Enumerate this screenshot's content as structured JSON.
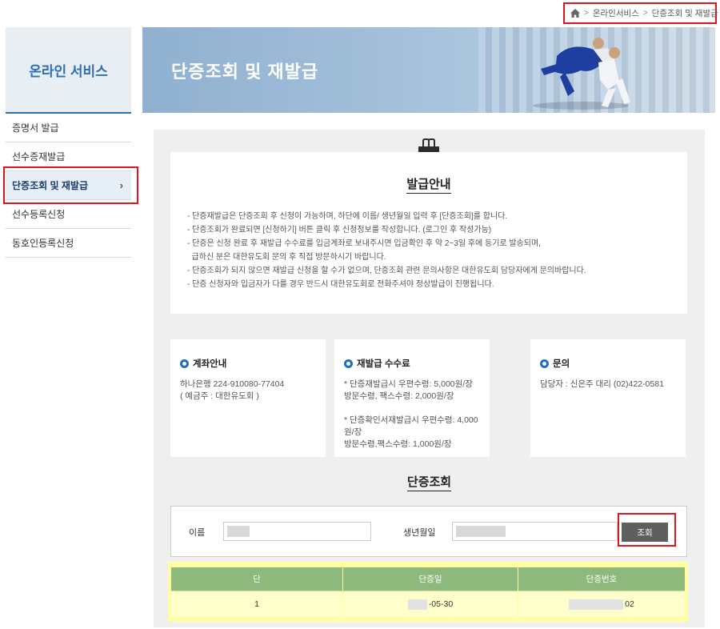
{
  "breadcrumb": {
    "home_icon": "home-icon",
    "items": [
      "온라인서비스",
      "단증조회 및 재발급"
    ],
    "separator": ">"
  },
  "sidebar": {
    "title": "온라인 서비스",
    "items": [
      {
        "label": "증명서 발급"
      },
      {
        "label": "선수증재발급"
      },
      {
        "label": "단증조회 및 재발급",
        "active": true,
        "chevron": "chevron-right-icon"
      },
      {
        "label": "선수등록신청"
      },
      {
        "label": "동호인등록신청"
      }
    ]
  },
  "banner": {
    "title": "단증조회 및 재발급"
  },
  "notice": {
    "icon": "clipboard-icon",
    "title": "발급안내",
    "lines": [
      "- 단증재발급은 단증조회 후 신청이 가능하며, 하단에 이름/ 생년월일 입력 후 [단증조회]를 합니다.",
      "- 단증조회가 완료되면 [신청하기] 버튼 클릭 후 신청정보를 작성합니다. (로그인 후 작성가능)",
      "- 단증은 신청 완료 후 재발급 수수료를 입금계좌로 보내주시면 입금확인 후 약 2~3일 후에 등기로 발송되며,",
      "  급하신 분은 대한유도회 문의 후 직접 방문하시기 바랍니다.",
      "- 단증조회가 되지 않으면 재발급 신청을 할 수가 없으며, 단증조회 관련 문의사항은 대한유도회 담당자에게 문의바랍니다.",
      "- 단증 신청자와 입금자가 다를 경우 반드시 대한유도회로 전화주셔야 정상발급이 진행됩니다."
    ]
  },
  "cards": {
    "account": {
      "title": "계좌안내",
      "line1": "하나은행 224-910080-77404",
      "line2": "( 예금주 : 대한유도회 )"
    },
    "fee": {
      "title": "재발급 수수료",
      "line1": "* 단증재발급시 우편수령: 5,000원/장",
      "line2": "방문수령, 팩스수령: 2,000원/장",
      "line3": "* 단증확인서재발급시 우편수령: 4,000원/장",
      "line4": "방문수령,팩스수령: 1,000원/장"
    },
    "contact": {
      "title": "문의",
      "line1": "담당자 : 신은주 대리 (02)422-0581"
    }
  },
  "lookup": {
    "title": "단증조회",
    "name_label": "이름",
    "birth_label": "생년월일",
    "search_button": "조회"
  },
  "table": {
    "headers": [
      "단",
      "단증일",
      "단증번호"
    ],
    "rows": [
      {
        "dan": "1",
        "date": "-05-30",
        "number": "02"
      }
    ]
  }
}
